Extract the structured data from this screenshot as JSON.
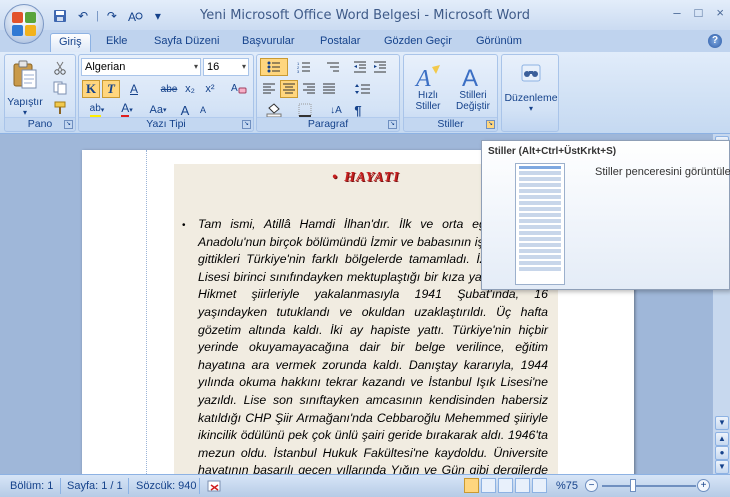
{
  "window": {
    "title": "Yeni Microsoft Office Word Belgesi - Microsoft Word",
    "minimize": "–",
    "maximize": "□",
    "close": "×"
  },
  "qat": {
    "undo_label": "↶",
    "redo_label": "↷",
    "sep": "|",
    "more": "▾"
  },
  "tabs": [
    {
      "label": "Giriş",
      "active": true
    },
    {
      "label": "Ekle"
    },
    {
      "label": "Sayfa Düzeni"
    },
    {
      "label": "Başvurular"
    },
    {
      "label": "Postalar"
    },
    {
      "label": "Gözden Geçir"
    },
    {
      "label": "Görünüm"
    }
  ],
  "ribbon": {
    "clipboard": {
      "paste_label": "Yapıştır",
      "group_label": "Pano"
    },
    "font": {
      "font_name": "Algerian",
      "font_size": "16",
      "bold": "K",
      "italic": "T",
      "underline": "A",
      "strike": "abe",
      "subscript": "x₂",
      "superscript": "x²",
      "change_case": "Aa",
      "grow": "A",
      "shrink": "A",
      "highlight": "ab",
      "font_color": "A",
      "group_label": "Yazı Tipi"
    },
    "paragraph": {
      "sort": "↓A",
      "show_marks": "¶",
      "group_label": "Paragraf"
    },
    "styles": {
      "quick_styles_line1": "Hızlı",
      "quick_styles_line2": "Stiller",
      "change_styles_line1": "Stilleri",
      "change_styles_line2": "Değiştir",
      "group_label": "Stiller"
    },
    "editing": {
      "label": "Düzenleme"
    }
  },
  "tooltip": {
    "title": "Stiller (Alt+Ctrl+ÜstKrkt+S)",
    "description": "Stiller penceresini görüntüle"
  },
  "document": {
    "heading": "HAYATI",
    "heading_bullet": "•",
    "paragraph_bullet": "•",
    "body": "Tam ismi, Atillâ Hamdi İlhan'dır. İlk ve orta eğitimini Batı Anadolu'nun birçok bölümündü İzmir ve babasının işi dolayısıyla gittikleri Türkiye'nin farklı bölgelerde tamamladı. İzmir Atatürk Lisesi birinci sınıfındayken mektuplaştığı bir kıza yazdığı Nazım Hikmet şiirleriyle yakalanmasıyla 1941 Şubat'ında, 16 yaşındayken tutuklandı ve okuldan uzaklaştırıldı. Üç hafta gözetim altında kaldı. İki ay hapiste yattı. Türkiye'nin hiçbir yerinde okuyamayacağına dair bir belge verilince, eğitim hayatına ara vermek zorunda kaldı. Danıştay kararıyla, 1944 yılında okuma hakkını tekrar kazandı ve İstanbul Işık Lisesi'ne yazıldı. Lise son sınıftayken amcasının kendisinden habersiz katıldığı CHP Şiir Armağanı'nda Cebbaroğlu Mehemmed şiiriyle ikincilik ödülünü pek çok ünlü şairi geride bırakarak aldı. 1946'ta mezun oldu. İstanbul Hukuk Fakültesi'ne kaydoldu. Üniversite hayatının başarılı geçen yıllarında Yığın ve Gün gibi dergilerde ilk şiirleri"
  },
  "statusbar": {
    "section": "Bölüm: 1",
    "page": "Sayfa: 1 / 1",
    "words": "Sözcük: 940",
    "zoom": "%75",
    "zoom_out": "−",
    "zoom_in": "+"
  },
  "colors": {
    "accent": "#15428b",
    "heading_red": "#c62020",
    "page_tint": "#f1ece1"
  }
}
